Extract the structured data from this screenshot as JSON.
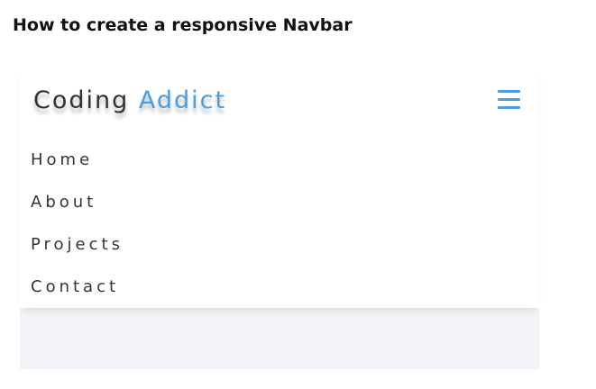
{
  "page": {
    "heading": "How to create a responsive Navbar"
  },
  "navbar": {
    "logo_primary": "Coding",
    "logo_accent": "Addict",
    "menu_icon": "hamburger-menu-icon",
    "links": [
      {
        "label": "Home"
      },
      {
        "label": "About"
      },
      {
        "label": "Projects"
      },
      {
        "label": "Contact"
      }
    ]
  },
  "colors": {
    "accent": "#4a9edd",
    "text": "#2f3440",
    "frame_background": "#f1f3f6",
    "navbar_background": "#ffffff"
  }
}
